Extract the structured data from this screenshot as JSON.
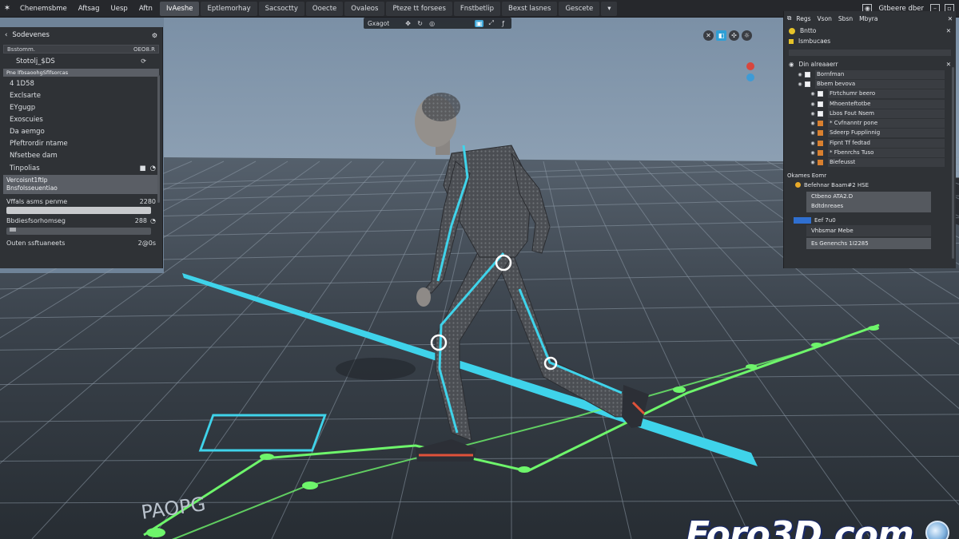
{
  "menu": {
    "items": [
      "Chenemsbme",
      "Aftsag",
      "Uesp",
      "Aftn"
    ],
    "workspace_tabs": [
      {
        "label": "IvAeshe",
        "active": true
      },
      {
        "label": "Eptlemorhay",
        "active": false
      },
      {
        "label": "Sacsoctty",
        "active": false
      },
      {
        "label": "Ooecte",
        "active": false
      },
      {
        "label": "Ovaleos",
        "active": false
      },
      {
        "label": "Pteze tt forsees",
        "active": false
      },
      {
        "label": "Fnstbetlip",
        "active": false
      },
      {
        "label": "Bexst lasnes",
        "active": false
      },
      {
        "label": "Gescete",
        "active": false
      }
    ],
    "right_label": "Gtbeere dber"
  },
  "viewport": {
    "mode_label": "Gxagot",
    "floor_text": "PAOPG",
    "accent_color": "#3fd3ea",
    "path_color": "#6ef56b"
  },
  "left_panel": {
    "title": "Sodevenes",
    "field1_label": "Bsstomm.",
    "field1_value": "OEO8.R",
    "object_label": "Stotolj_$DS",
    "selected_row": "Pne lfbsaoohgSflfsorcas",
    "list": [
      "4 1D58",
      "Exclsarte",
      "EYgugp",
      "Exoscuies",
      "Da aemgo",
      "Pfeftrordir ntame",
      "Nfsetbee dam"
    ],
    "group_label": "Tinpolias",
    "highlight_line1": "Vercoisnt1ftlp",
    "highlight_line2": "Bnsfolsseuentiao",
    "slider1_label": "Vffals asms penme",
    "slider1_value": "2280",
    "slider2_label": "Bbdiesfsorhomseg",
    "slider2_value": "288",
    "footer_label": "Outen ssftuaneets",
    "footer_value": "2@0s"
  },
  "right_panel": {
    "tabs": [
      "Regs",
      "Vson",
      "Sbsn",
      "Mbyra"
    ],
    "header_label": "Bntto",
    "section_label": "Ismbucaes",
    "outliner_title": "Din alreaaerr",
    "tree_items": [
      {
        "label": "Bornfman",
        "color": "white"
      },
      {
        "label": "Bbem bevova",
        "color": "white"
      },
      {
        "label": "Ftrtchumr beero",
        "color": "white"
      },
      {
        "label": "Mhoenteftotbe",
        "color": "white"
      },
      {
        "label": "Lbos Fout Nsem",
        "color": "white"
      },
      {
        "label": "* Cvfnanntr pone",
        "color": "orange"
      },
      {
        "label": "Sdeerp Fupplinnig",
        "color": "orange"
      },
      {
        "label": "Fipnt Tf fedtad",
        "color": "orange"
      },
      {
        "label": "* Fbenrchs Tuso",
        "color": "orange"
      },
      {
        "label": "Biefeusst",
        "color": "orange"
      }
    ],
    "props_title": "Okames Eomr",
    "props_row": "Befehnar Baam#2 HSE",
    "props_box1_line1": "Ctbeno  ATA2.D",
    "props_box1_line2": "Bdtdnreaes",
    "section2_label": "Eef 7u0",
    "props_box2": "Vhbsmar Mebe",
    "props_box3": "Es Genenchs 1I2285"
  },
  "watermark": {
    "text": "Foro3D.com"
  }
}
